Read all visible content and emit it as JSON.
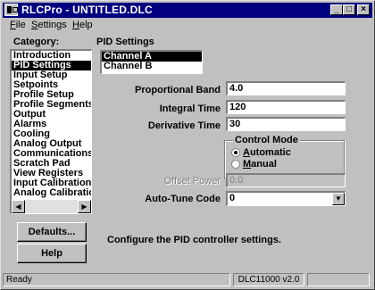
{
  "window": {
    "title": "RLCPro - UNTITLED.DLC",
    "minimize": "_",
    "maximize": "□",
    "close": "×"
  },
  "menu": [
    {
      "label": "File",
      "accel": "F",
      "rest": "ile"
    },
    {
      "label": "Settings",
      "accel": "S",
      "rest": "ettings"
    },
    {
      "label": "Help",
      "accel": "H",
      "rest": "elp"
    }
  ],
  "sidebar": {
    "category_label": "Category:",
    "items": [
      "Introduction",
      "PID Settings",
      "Input Setup",
      "Setpoints",
      "Profile Setup",
      "Profile Segments",
      "Output",
      "Alarms",
      "Cooling",
      "Analog Output",
      "Communications",
      "Scratch Pad",
      "View Registers",
      "Input Calibration",
      "Analog Calibration"
    ],
    "selected_index": 1,
    "scroll_left": "◀",
    "scroll_right": "▶",
    "defaults_button": "Defaults...",
    "help_button": "Help"
  },
  "pid": {
    "title": "PID Settings",
    "channels": [
      "Channel A",
      "Channel B"
    ],
    "selected_channel": 0,
    "proportional_band": {
      "label": "Proportional Band",
      "value": "4.0"
    },
    "integral_time": {
      "label": "Integral Time",
      "value": "120"
    },
    "derivative_time": {
      "label": "Derivative Time",
      "value": "30"
    },
    "control_mode": {
      "title": "Control Mode",
      "automatic": {
        "accel": "A",
        "rest": "utomatic",
        "checked": true
      },
      "manual": {
        "accel": "M",
        "rest": "anual",
        "checked": false
      }
    },
    "offset_power": {
      "label": "Offset Power",
      "value": "0.0"
    },
    "auto_tune_code": {
      "label": "Auto-Tune Code",
      "value": "0",
      "arrow": "▼"
    },
    "hint": "Configure the PID controller settings."
  },
  "status": {
    "left": "Ready",
    "middle": "DLC11000 v2.0",
    "right": ""
  }
}
